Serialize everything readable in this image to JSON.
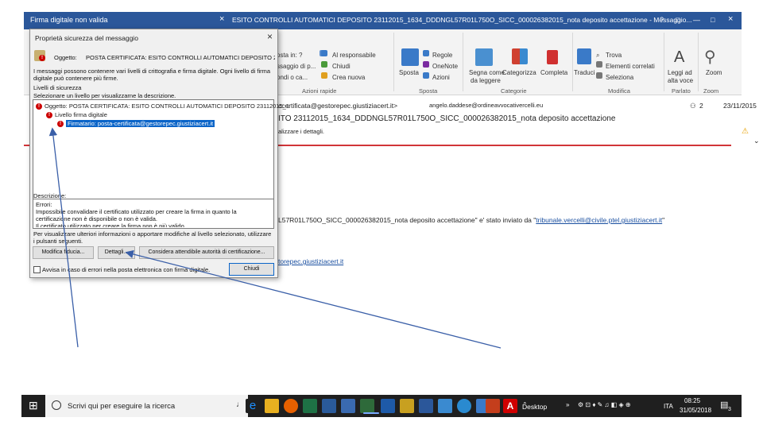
{
  "window": {
    "back_title": "Firma digitale non valida",
    "main_title": "ESITO CONTROLLI AUTOMATICI DEPOSITO 23112015_1634_DDDNGL57R01L750O_SICC_000026382015_nota deposito accettazione  -  Messaggio...",
    "close_glyph": "×",
    "win_controls": [
      "?",
      "□",
      "—",
      "□",
      "×"
    ]
  },
  "ribbon": {
    "left_items": [
      "osta in: ?",
      "ssaggio di p...",
      "ondi o ca..."
    ],
    "responsabile": "Al responsabile",
    "chiudi": "Chiudi",
    "crea_nuova": "Crea nuova",
    "sposta": "Sposta",
    "regole": "Regole",
    "onenote": "OneNote",
    "azioni": "Azioni",
    "segna_come": "Segna come",
    "da_leggere": "da leggere",
    "categorizza": "Categorizza",
    "completa": "Completa",
    "traduci": "Traduci",
    "trova": "Trova",
    "elementi_correlati": "Elementi correlati",
    "seleziona": "Seleziona",
    "leggi_ad": "Leggi ad",
    "alta_voce": "alta voce",
    "zoom": "Zoom",
    "groups": [
      "Azioni rapide",
      "Sposta",
      "Categorie",
      "Modifica",
      "Parlato",
      "Zoom"
    ]
  },
  "message": {
    "from": "ccertificata@gestorepec.giustiziacert.it>",
    "to": "angelo.daddese@ordineavvocativercelli.eu",
    "count": "2",
    "date": "23/11/2015",
    "subject": "ITO 23112015_1634_DDDNGL57R01L750O_SICC_000026382015_nota deposito accettazione",
    "infobar": "alizzare i dettagli.",
    "body_line": "L57R01L750O_SICC_000026382015_nota deposito accettazione\" e' stato inviato da \"",
    "body_link": "tribunale.vercelli@civile.ptel.giustiziacert.it",
    "body_end": "\"",
    "sender_link": "torepec.giustiziacert.it"
  },
  "dialog": {
    "title": "Proprietà sicurezza del messaggio",
    "oggetto_label": "Oggetto:",
    "oggetto_value": "POSTA CERTIFICATA: ESITO CONTROLLI AUTOMATICI DEPOSITO 23112O",
    "info": "I messaggi possono contenere vari livelli di crittografia e firma digitale. Ogni livello di firma digitale può contenere più firme.",
    "livelli": "Livelli di sicurezza",
    "seleziona": "Selezionare un livello per visualizzarne la descrizione.",
    "tree": [
      "Oggetto: POSTA CERTIFICATA: ESITO CONTROLLI AUTOMATICI DEPOSITO 23112015_1",
      "Livello firma digitale",
      "Firmatario: posta-certificata@gestorepec.giustiziacert.it"
    ],
    "descrizione": "Descrizione:",
    "desc_lines": [
      "Errori:",
      "Impossibile convalidare il certificato utilizzato per creare la firma in quanto la",
      "certificazione non è disponibile o non è valida.",
      "Il certificato utilizzato per creare la firma non è più valido."
    ],
    "hint": "Per visualizzare ulteriori informazioni o apportare modifiche al livello selezionato, utilizzare i pulsanti seguenti.",
    "btn_modifica": "Modifica fiducia...",
    "btn_dettagli": "Dettagli...",
    "btn_considera": "Considera attendibile autorità di certificazione...",
    "checkbox": "Avvisa in caso di errori nella posta elettronica con firma digitale.",
    "btn_chiudi": "Chiudi"
  },
  "taskbar": {
    "search_placeholder": "Scrivi qui per eseguire la ricerca",
    "desktop": "Desktop",
    "lang": "ITA",
    "time": "08:25",
    "date": "31/05/2018",
    "notify": "3"
  },
  "colors": {
    "title_blue": "#2b579a",
    "error_red": "#c00000",
    "select_blue": "#0a64c8",
    "taskbar": "#1f1f1f",
    "arrow": "#3a5fa8"
  }
}
